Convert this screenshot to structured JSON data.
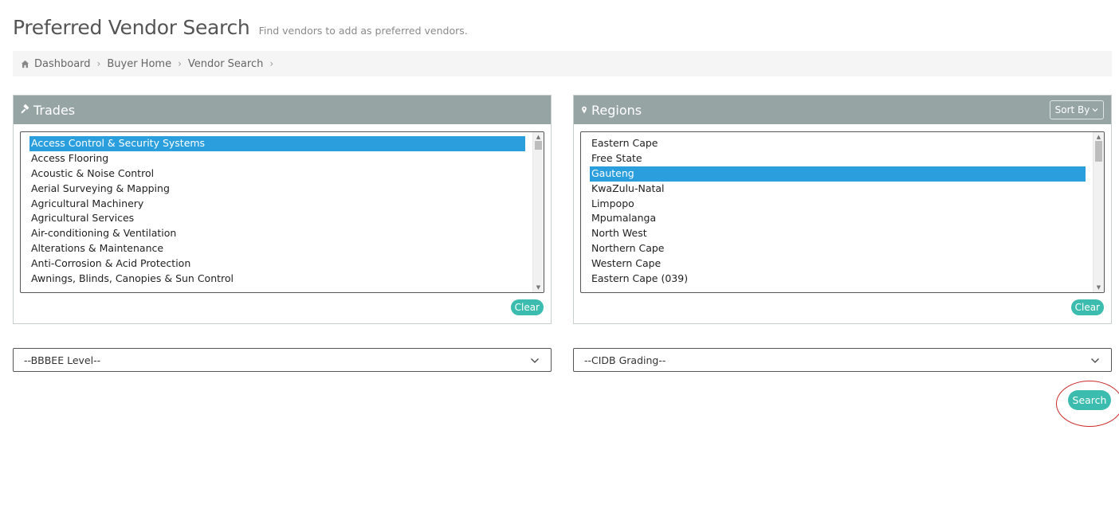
{
  "header": {
    "title": "Preferred Vendor Search",
    "subtitle": "Find vendors to add as preferred vendors."
  },
  "breadcrumb": [
    {
      "label": "Dashboard",
      "icon": "home-icon"
    },
    {
      "label": "Buyer Home"
    },
    {
      "label": "Vendor Search"
    }
  ],
  "trades": {
    "title": "Trades",
    "icon": "gavel-icon",
    "items": [
      "Access Control & Security Systems",
      "Access Flooring",
      "Acoustic & Noise Control",
      "Aerial Surveying & Mapping",
      "Agricultural Machinery",
      "Agricultural Services",
      "Air-conditioning & Ventilation",
      "Alterations & Maintenance",
      "Anti-Corrosion & Acid Protection",
      "Awnings, Blinds, Canopies & Sun Control"
    ],
    "selected": "Access Control & Security Systems",
    "clear_label": "Clear"
  },
  "regions": {
    "title": "Regions",
    "icon": "map-marker-icon",
    "sort_label": "Sort By",
    "items": [
      "Eastern Cape",
      "Free State",
      "Gauteng",
      "KwaZulu-Natal",
      "Limpopo",
      "Mpumalanga",
      "North West",
      "Northern Cape",
      "Western Cape",
      "Eastern Cape (039)"
    ],
    "selected": "Gauteng",
    "clear_label": "Clear"
  },
  "filters": {
    "bbbee_value": "--BBBEE Level--",
    "cidb_value": "--CIDB Grading--"
  },
  "actions": {
    "search_label": "Search"
  },
  "colors": {
    "panel_header": "#96a4a4",
    "selection": "#2b9fde",
    "accent_button": "#3bbcae",
    "annotation_ring": "#cc2a2a"
  }
}
